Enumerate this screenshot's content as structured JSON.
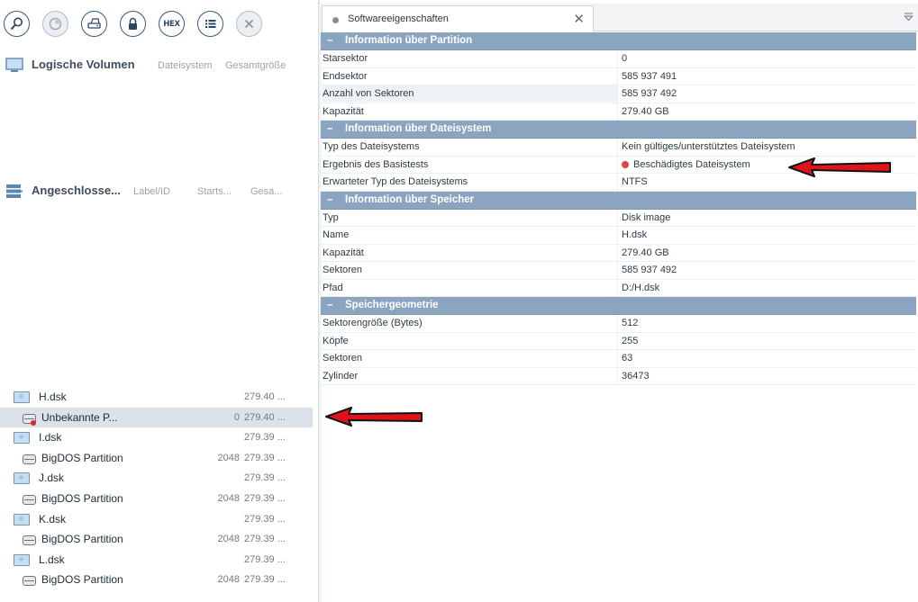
{
  "toolbar": {
    "buttons": [
      {
        "name": "search",
        "icon": "search-icon"
      },
      {
        "name": "analyze",
        "icon": "pie-chart-icon"
      },
      {
        "name": "drive",
        "icon": "drive-icon"
      },
      {
        "name": "lock",
        "icon": "lock-icon"
      },
      {
        "name": "hex",
        "icon": "hex-icon",
        "label": "HEX"
      },
      {
        "name": "list",
        "icon": "list-icon"
      },
      {
        "name": "close",
        "icon": "close-icon"
      }
    ]
  },
  "logical_volumes": {
    "title": "Logische Volumen",
    "col_filesystem": "Dateisystem",
    "col_total": "Gesamtgröße"
  },
  "connected": {
    "title": "Angeschlosse...",
    "col_label": "Label/ID",
    "col_start": "Starts...",
    "col_size": "Gesa..."
  },
  "tree": [
    {
      "type": "disk",
      "name": "H.dsk",
      "start": "",
      "size": "279.40 ...",
      "selected": false
    },
    {
      "type": "partition",
      "name": "Unbekannte P...",
      "start": "0",
      "size": "279.40 ...",
      "selected": true,
      "error": true
    },
    {
      "type": "disk",
      "name": "I.dsk",
      "start": "",
      "size": "279.39 ...",
      "selected": false
    },
    {
      "type": "partition",
      "name": "BigDOS Partition",
      "start": "2048",
      "size": "279.39 ...",
      "selected": false
    },
    {
      "type": "disk",
      "name": "J.dsk",
      "start": "",
      "size": "279.39 ...",
      "selected": false
    },
    {
      "type": "partition",
      "name": "BigDOS Partition",
      "start": "2048",
      "size": "279.39 ...",
      "selected": false
    },
    {
      "type": "disk",
      "name": "K.dsk",
      "start": "",
      "size": "279.39 ...",
      "selected": false
    },
    {
      "type": "partition",
      "name": "BigDOS Partition",
      "start": "2048",
      "size": "279.39 ...",
      "selected": false
    },
    {
      "type": "disk",
      "name": "L.dsk",
      "start": "",
      "size": "279.39 ...",
      "selected": false
    },
    {
      "type": "partition",
      "name": "BigDOS Partition",
      "start": "2048",
      "size": "279.39 ...",
      "selected": false
    }
  ],
  "tab": {
    "label": "Softwareeigenschaften",
    "close": "✕"
  },
  "groups": [
    {
      "title": "Information über Partition",
      "rows": [
        {
          "key": "Starsektor",
          "value": "0"
        },
        {
          "key": "Endsektor",
          "value": "585 937 491"
        },
        {
          "key": "Anzahl von Sektoren",
          "value": "585 937 492",
          "highlight": true
        },
        {
          "key": "Kapazität",
          "value": "279.40 GB"
        }
      ]
    },
    {
      "title": "Information über Dateisystem",
      "rows": [
        {
          "key": "Typ des Dateisystems",
          "value": "Kein gültiges/unterstütztes Dateisystem"
        },
        {
          "key": "Ergebnis des Basistests",
          "value": "Beschädigtes Dateisystem",
          "status": "error"
        },
        {
          "key": "Erwarteter Typ des Dateisystems",
          "value": "NTFS"
        }
      ]
    },
    {
      "title": "Information über Speicher",
      "rows": [
        {
          "key": "Typ",
          "value": "Disk image"
        },
        {
          "key": "Name",
          "value": "H.dsk"
        },
        {
          "key": "Kapazität",
          "value": "279.40 GB"
        },
        {
          "key": "Sektoren",
          "value": "585 937 492"
        },
        {
          "key": "Pfad",
          "value": "D:/H.dsk"
        }
      ]
    },
    {
      "title": "Speichergeometrie",
      "rows": [
        {
          "key": "Sektorengröße (Bytes)",
          "value": "512"
        },
        {
          "key": "Köpfe",
          "value": "255"
        },
        {
          "key": "Sektoren",
          "value": "63"
        },
        {
          "key": "Zylinder",
          "value": "36473"
        }
      ]
    }
  ],
  "colors": {
    "group_header": "#8ba5c0",
    "error": "#d84a3f",
    "annotation_arrow": "#e0131a"
  }
}
